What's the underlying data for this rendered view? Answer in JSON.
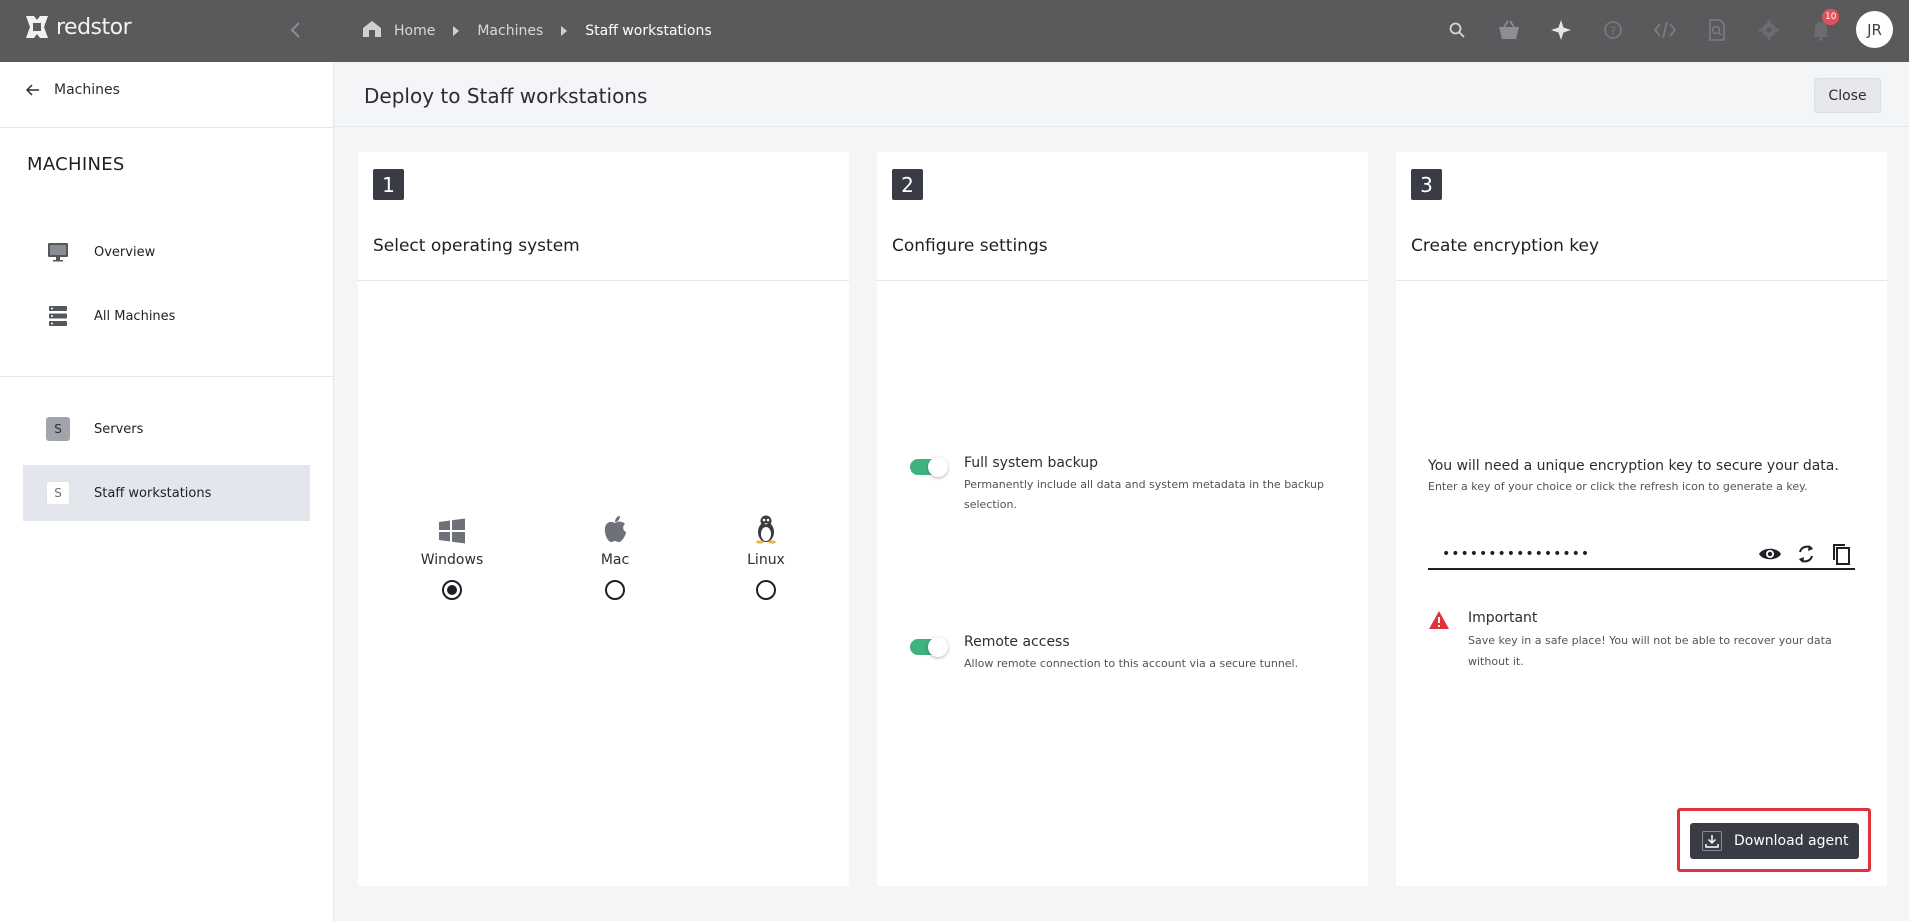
{
  "app": {
    "brand": "redstor"
  },
  "breadcrumb": {
    "home": "Home",
    "machines": "Machines",
    "current": "Staff workstations"
  },
  "topbar": {
    "notification_count": "10",
    "avatar_initials": "JR"
  },
  "sidebar": {
    "back_label": "Machines",
    "section_title": "MACHINES",
    "nav": [
      {
        "label": "Overview",
        "icon": "monitor-icon"
      },
      {
        "label": "All Machines",
        "icon": "servers-icon"
      }
    ],
    "groups": [
      {
        "letter": "S",
        "label": "Servers",
        "active": false
      },
      {
        "letter": "S",
        "label": "Staff workstations",
        "active": true
      }
    ]
  },
  "page": {
    "title": "Deploy to Staff workstations",
    "close_label": "Close"
  },
  "steps": [
    {
      "number": "1",
      "title": "Select operating system"
    },
    {
      "number": "2",
      "title": "Configure settings"
    },
    {
      "number": "3",
      "title": "Create encryption key"
    }
  ],
  "os_options": [
    {
      "label": "Windows",
      "selected": true,
      "icon": "windows-icon"
    },
    {
      "label": "Mac",
      "selected": false,
      "icon": "apple-icon"
    },
    {
      "label": "Linux",
      "selected": false,
      "icon": "linux-icon"
    }
  ],
  "settings": [
    {
      "title": "Full system backup",
      "desc": "Permanently include all data and system metadata in the backup selection.",
      "enabled": true
    },
    {
      "title": "Remote access",
      "desc": "Allow remote connection to this account via a secure tunnel.",
      "enabled": true
    }
  ],
  "encryption": {
    "heading": "You will need a unique encryption key to secure your data.",
    "subheading": "Enter a key of your choice or click the refresh icon to generate a key.",
    "key_value": "••••••••••••••••",
    "important_title": "Important",
    "important_desc": "Save key in a safe place! You will not be able to recover your data without it.",
    "download_label": "Download agent"
  },
  "colors": {
    "topbar": "#5a5a5c",
    "toggle_on": "#3fb27f",
    "step_badge": "#3a3c45",
    "highlight": "#e0323a",
    "warning": "#e0323a"
  }
}
